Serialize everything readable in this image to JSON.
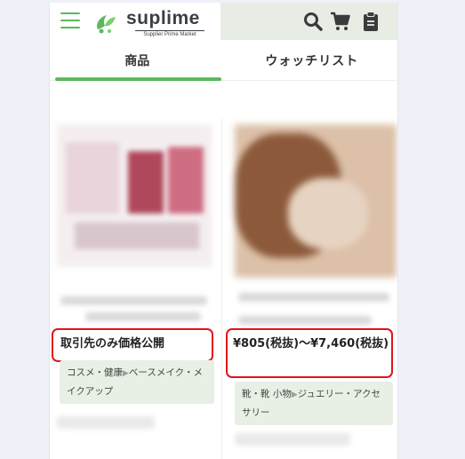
{
  "app": {
    "logo_text": "suplime",
    "logo_subtitle": "Supplier Prime Market",
    "brand_green": "#5cb85c",
    "alert_red": "#e0151a"
  },
  "header": {
    "icons": [
      "menu-icon",
      "search-icon",
      "cart-icon",
      "clipboard-icon"
    ]
  },
  "tabs": [
    {
      "label": "商品",
      "active": true
    },
    {
      "label": "ウォッチリスト",
      "active": false
    }
  ],
  "products": [
    {
      "price": "取引先のみ価格公開",
      "category_main": "コスメ・健康",
      "category_sub": "ベースメイク・メイクアップ"
    },
    {
      "price": "¥805(税抜)～¥7,460(税抜)",
      "category_main": "靴・靴 小物",
      "category_sub": "ジュエリー・アクセサリー"
    }
  ]
}
